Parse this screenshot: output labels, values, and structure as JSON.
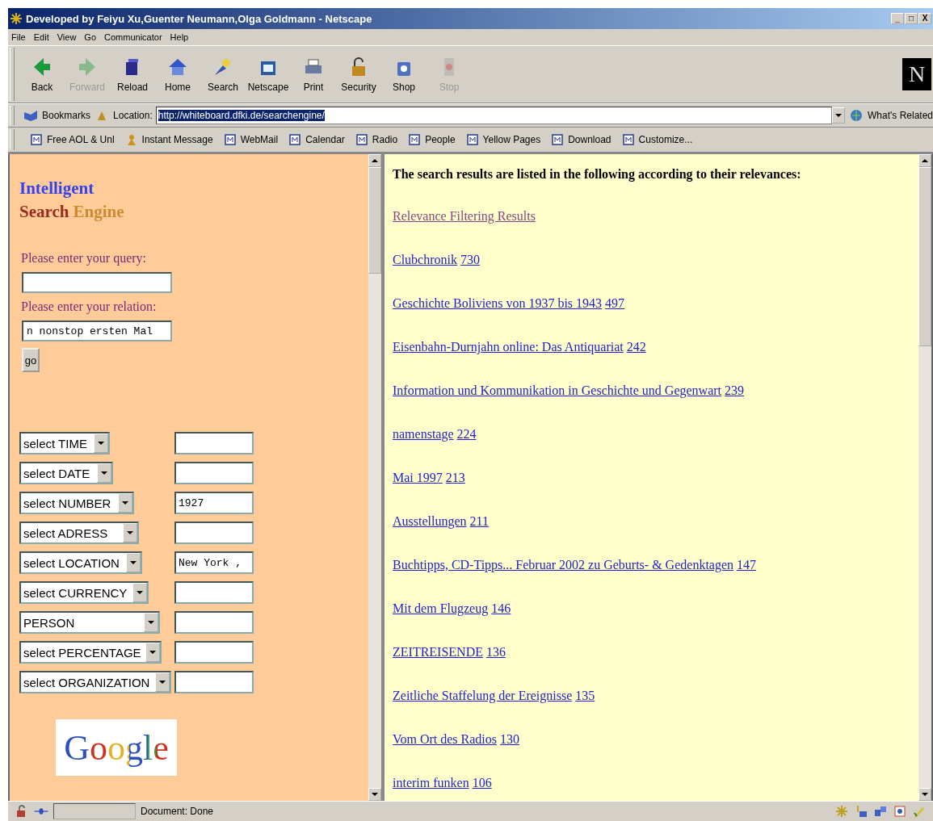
{
  "window": {
    "title": "Developed by Feiyu Xu,Guenter Neumann,Olga Goldmann - Netscape",
    "controls": [
      "_",
      "□",
      "X"
    ]
  },
  "menu": [
    "File",
    "Edit",
    "View",
    "Go",
    "Communicator",
    "Help"
  ],
  "toolbar": [
    {
      "label": "Back",
      "disabled": false
    },
    {
      "label": "Forward",
      "disabled": true
    },
    {
      "label": "Reload",
      "disabled": false
    },
    {
      "label": "Home",
      "disabled": false
    },
    {
      "label": "Search",
      "disabled": false
    },
    {
      "label": "Netscape",
      "disabled": false
    },
    {
      "label": "Print",
      "disabled": false
    },
    {
      "label": "Security",
      "disabled": false
    },
    {
      "label": "Shop",
      "disabled": false
    },
    {
      "label": "Stop",
      "disabled": true
    }
  ],
  "brand_letter": "N",
  "location_bar": {
    "bookmarks": "Bookmarks",
    "location_label": "Location:",
    "url": "http://whiteboard.dfki.de/searchengine/",
    "related": "What's Related"
  },
  "personal_toolbar": [
    {
      "label": "Free AOL & Unl",
      "kind": "page"
    },
    {
      "label": "Instant Message",
      "kind": "person"
    },
    {
      "label": "WebMail",
      "kind": "page"
    },
    {
      "label": "Calendar",
      "kind": "page"
    },
    {
      "label": "Radio",
      "kind": "page"
    },
    {
      "label": "People",
      "kind": "page"
    },
    {
      "label": "Yellow Pages",
      "kind": "page"
    },
    {
      "label": "Download",
      "kind": "page"
    },
    {
      "label": "Customize...",
      "kind": "page"
    }
  ],
  "left_frame": {
    "title": "Intelligent",
    "subtitle": [
      {
        "text": "Search",
        "color": "#9a2a1a"
      },
      {
        "text": "Engine",
        "color": "#cc8a33"
      }
    ],
    "query_label": "Please enter your query:",
    "relation_label": "Please enter your relation:",
    "relation_value": "n nonstop ersten Mal",
    "go": "go",
    "entity_rows": [
      {
        "select": "select TIME",
        "value": ""
      },
      {
        "select": "select DATE",
        "value": ""
      },
      {
        "select": "select NUMBER",
        "value": "1927"
      },
      {
        "select": "select ADRESS",
        "value": ""
      },
      {
        "select": "select LOCATION",
        "value": "New York ,"
      },
      {
        "select": "select CURRENCY",
        "value": ""
      },
      {
        "select": "PERSON",
        "value": ""
      },
      {
        "select": "select PERCENTAGE",
        "value": ""
      },
      {
        "select": "select ORGANIZATION",
        "value": ""
      }
    ],
    "logo": "Google"
  },
  "right_frame": {
    "heading": "The search results are listed in the following according to their relevances:",
    "filter_link": "Relevance Filtering Results",
    "results": [
      {
        "title": "Clubchronik",
        "score": "730"
      },
      {
        "title": "Geschichte Boliviens von 1937 bis 1943",
        "score": "497"
      },
      {
        "title": "Eisenbahn-Durnjahn online: Das Antiquariat",
        "score": "242"
      },
      {
        "title": "Information und Kommunikation in Geschichte und Gegenwart",
        "score": "239"
      },
      {
        "title": "namenstage",
        "score": "224"
      },
      {
        "title": "Mai 1997",
        "score": "213"
      },
      {
        "title": "Ausstellungen",
        "score": "211"
      },
      {
        "title": "Buchtipps, CD-Tipps... Februar 2002 zu Geburts- & Gedenktagen",
        "score": "147"
      },
      {
        "title": "Mit dem Flugzeug",
        "score": "146"
      },
      {
        "title": "ZEITREISENDE",
        "score": "136"
      },
      {
        "title": "Zeitliche Staffelung der Ereignisse",
        "score": "135"
      },
      {
        "title": "Vom Ort des Radios",
        "score": "130"
      },
      {
        "title": "interim funken",
        "score": "106"
      }
    ]
  },
  "status_bar": {
    "text": "Document: Done"
  }
}
